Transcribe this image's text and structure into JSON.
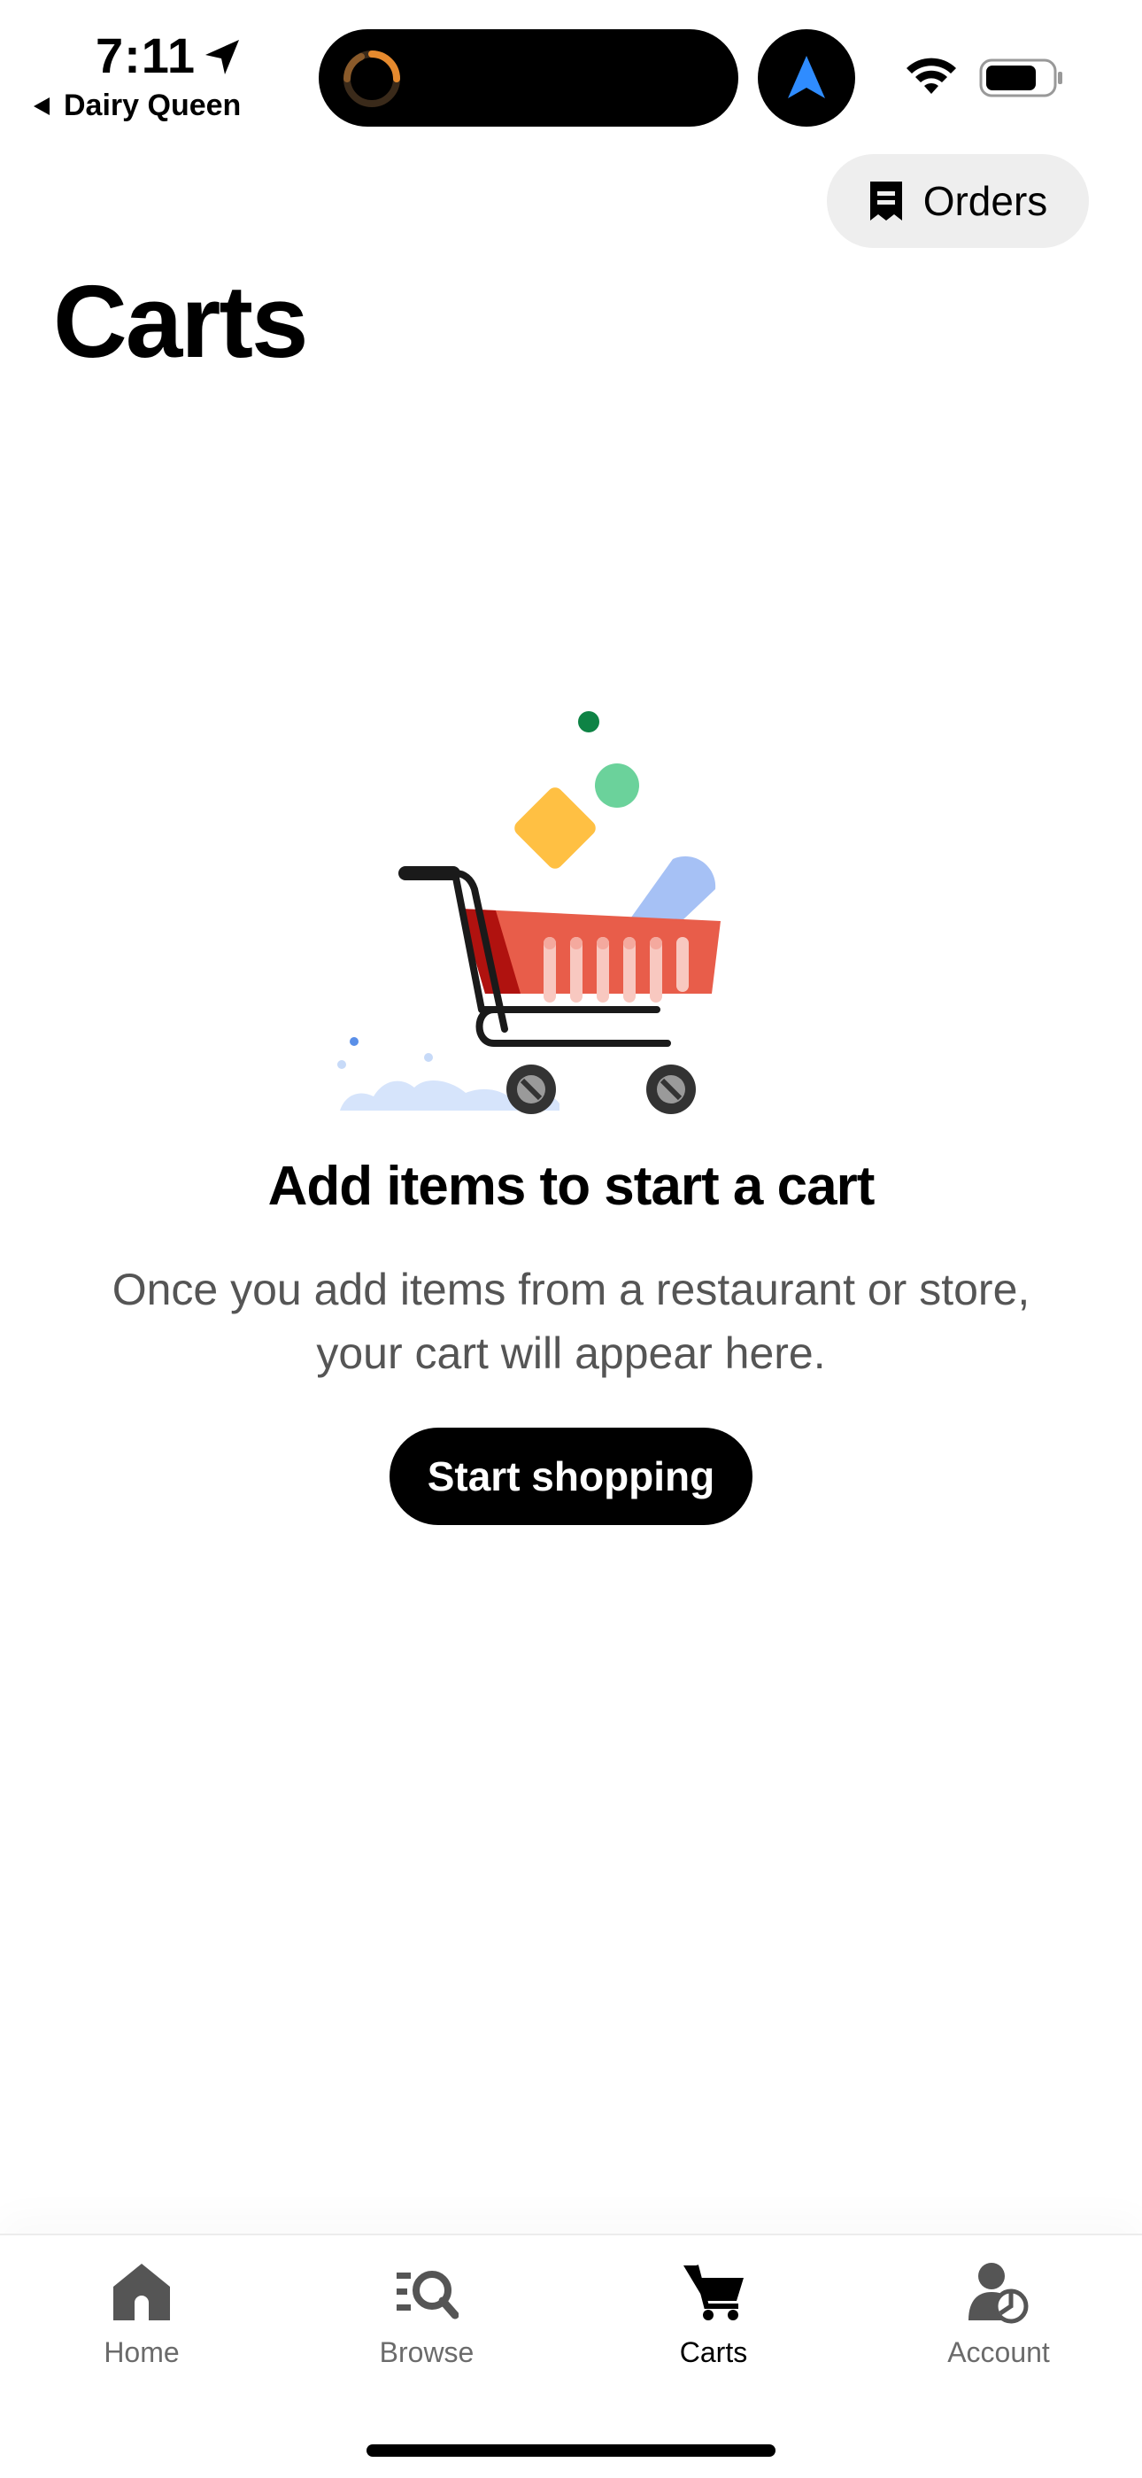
{
  "status_bar": {
    "time": "7:11",
    "back_app": "Dairy Queen"
  },
  "header": {
    "orders_label": "Orders",
    "title": "Carts"
  },
  "empty_state": {
    "title": "Add items to start a cart",
    "description": "Once you add items from a restaurant or store, your cart will appear here.",
    "button_label": "Start shopping"
  },
  "tabs": [
    {
      "label": "Home",
      "icon": "home-icon",
      "active": false
    },
    {
      "label": "Browse",
      "icon": "browse-icon",
      "active": false
    },
    {
      "label": "Carts",
      "icon": "cart-icon",
      "active": true
    },
    {
      "label": "Account",
      "icon": "account-icon",
      "active": false
    }
  ],
  "colors": {
    "accent": "#000000",
    "muted_text": "#6b6b6b",
    "cart_red": "#E85D4A",
    "nav_blue": "#2F8CFF"
  }
}
